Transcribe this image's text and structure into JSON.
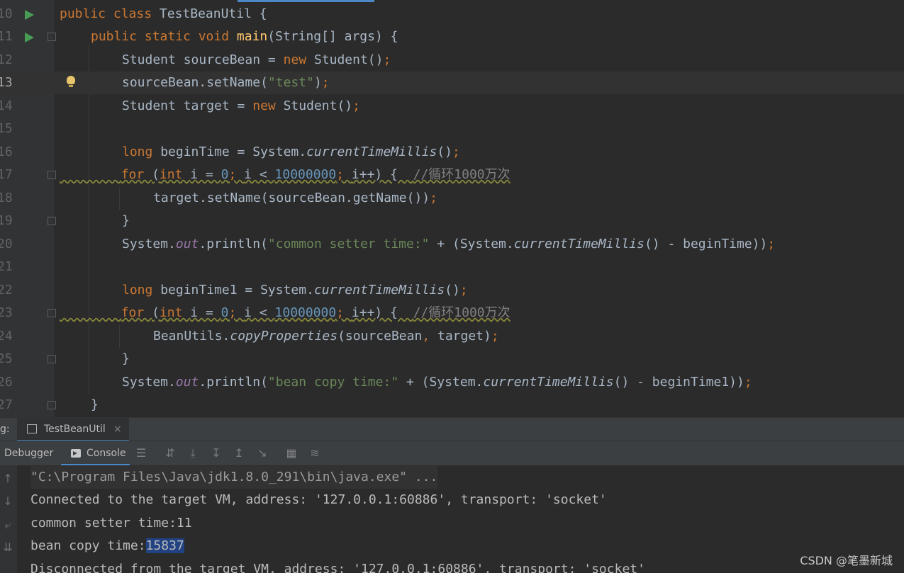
{
  "editor": {
    "lines": [
      {
        "num": "10",
        "text": "public class TestBeanUtil {"
      },
      {
        "num": "11",
        "text": "public static void main(String[] args) {"
      },
      {
        "num": "12",
        "text": "Student sourceBean = new Student();"
      },
      {
        "num": "13",
        "text": "sourceBean.setName(\"test\");"
      },
      {
        "num": "14",
        "text": "Student target = new Student();"
      },
      {
        "num": "15",
        "text": ""
      },
      {
        "num": "16",
        "text": "long beginTime = System.currentTimeMillis();"
      },
      {
        "num": "17",
        "text": "for (int i = 0; i < 10000000; i++) {  //循环1000万次"
      },
      {
        "num": "18",
        "text": "target.setName(sourceBean.getName());"
      },
      {
        "num": "19",
        "text": "}"
      },
      {
        "num": "20",
        "text": "System.out.println(\"common setter time:\" + (System.currentTimeMillis() - beginTime));"
      },
      {
        "num": "21",
        "text": ""
      },
      {
        "num": "22",
        "text": "long beginTime1 = System.currentTimeMillis();"
      },
      {
        "num": "23",
        "text": "for (int i = 0; i < 10000000; i++) {  //循环1000万次"
      },
      {
        "num": "24",
        "text": "BeanUtils.copyProperties(sourceBean, target);"
      },
      {
        "num": "25",
        "text": "}"
      },
      {
        "num": "26",
        "text": "System.out.println(\"bean copy time:\" + (System.currentTimeMillis() - beginTime1));"
      },
      {
        "num": "27",
        "text": "}"
      }
    ]
  },
  "run_panel": {
    "label": "g:",
    "tab_title": "TestBeanUtil",
    "tab_close": "×"
  },
  "toolbar": {
    "debugger_label": "Debugger",
    "console_label": "Console"
  },
  "console": {
    "cmd": "\"C:\\Program Files\\Java\\jdk1.8.0_291\\bin\\java.exe\" ...",
    "connected": "Connected to the target VM, address: '127.0.0.1:60886', transport: 'socket'",
    "common_prefix": "common setter time:",
    "common_value": "11",
    "bean_prefix": "bean copy time:",
    "bean_value": "15837",
    "disconnected": "Disconnected from the target VM, address: '127.0.0.1:60886', transport: 'socket'"
  },
  "watermark": "CSDN @笔墨新城"
}
